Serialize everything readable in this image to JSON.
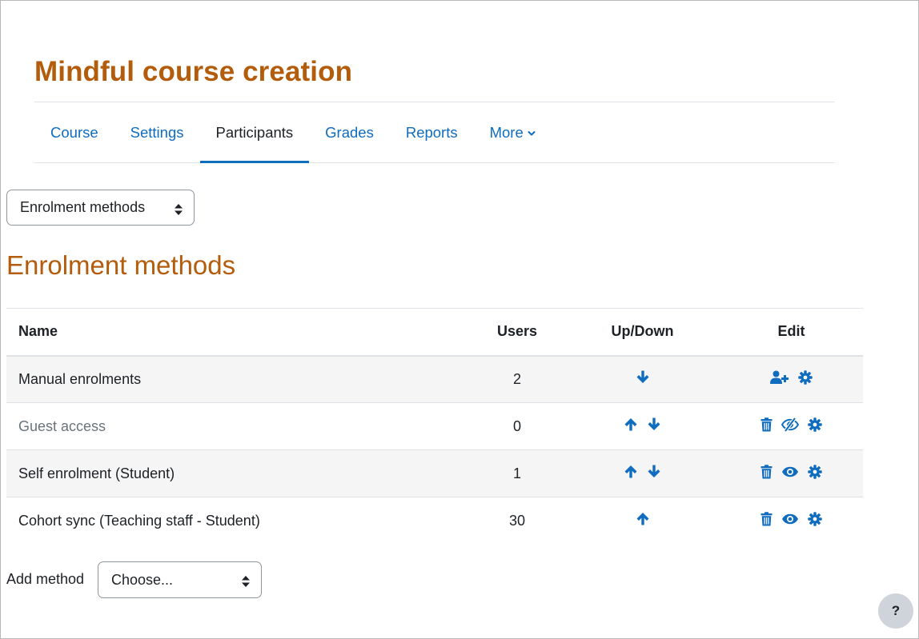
{
  "course": {
    "title": "Mindful course creation"
  },
  "nav": {
    "items": [
      {
        "label": "Course",
        "active": false
      },
      {
        "label": "Settings",
        "active": false
      },
      {
        "label": "Participants",
        "active": true
      },
      {
        "label": "Grades",
        "active": false
      },
      {
        "label": "Reports",
        "active": false
      },
      {
        "label": "More",
        "active": false
      }
    ]
  },
  "page_selector": {
    "value": "Enrolment methods"
  },
  "heading": "Enrolment methods",
  "table": {
    "headers": {
      "name": "Name",
      "users": "Users",
      "updown": "Up/Down",
      "edit": "Edit"
    },
    "rows": [
      {
        "name": "Manual enrolments",
        "users": "2",
        "up": false,
        "down": true,
        "edit": [
          "enrol-users-icon",
          "gear-icon"
        ],
        "dimmed": false
      },
      {
        "name": "Guest access",
        "users": "0",
        "up": true,
        "down": true,
        "edit": [
          "trash-icon",
          "eye-slash-icon",
          "gear-icon"
        ],
        "dimmed": true
      },
      {
        "name": "Self enrolment (Student)",
        "users": "1",
        "up": true,
        "down": true,
        "edit": [
          "trash-icon",
          "eye-icon",
          "gear-icon"
        ],
        "dimmed": false
      },
      {
        "name": "Cohort sync (Teaching staff - Student)",
        "users": "30",
        "up": true,
        "down": false,
        "edit": [
          "trash-icon",
          "eye-icon",
          "gear-icon"
        ],
        "dimmed": false
      }
    ]
  },
  "add_method": {
    "label": "Add method",
    "value": "Choose..."
  },
  "help": {
    "label": "?"
  },
  "colors": {
    "accent": "#0f6cbf",
    "heading": "#b35c0c",
    "text": "#1d2125"
  }
}
